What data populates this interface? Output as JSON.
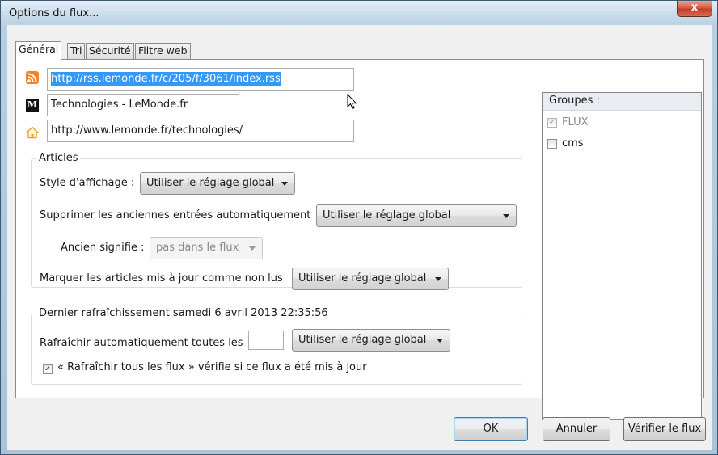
{
  "window": {
    "title": "Options du flux...",
    "close_label": "x"
  },
  "tabs": [
    {
      "label": "Général",
      "active": true
    },
    {
      "label": "Tri",
      "active": false
    },
    {
      "label": "Sécurité",
      "active": false
    },
    {
      "label": "Filtre web",
      "active": false
    }
  ],
  "feed": {
    "url": "http://rss.lemonde.fr/c/205/f/3061/index.rss",
    "name": "Technologies - LeMonde.fr",
    "homepage": "http://www.lemonde.fr/technologies/",
    "site_icon_text": "M"
  },
  "articles": {
    "legend": "Articles",
    "display_style_label": "Style d'affichage :",
    "display_style_value": "Utiliser le réglage global",
    "delete_old_label": "Supprimer les anciennes entrées automatiquement",
    "delete_old_value": "Utiliser le réglage global",
    "old_means_label": "Ancien signifie :",
    "old_means_value": "pas dans le flux",
    "mark_updated_label": "Marquer les articles mis à jour comme non lus",
    "mark_updated_value": "Utiliser le réglage global"
  },
  "refresh": {
    "legend": "Dernier rafraîchissement samedi 6 avril 2013 22:35:56",
    "auto_label": "Rafraîchir automatiquement toutes les",
    "interval_value": "",
    "auto_value": "Utiliser le réglage global",
    "refresh_all_label": "« Rafraîchir tous les flux » vérifie si ce flux a été mis à jour",
    "refresh_all_checked": true
  },
  "groups": {
    "header": "Groupes :",
    "items": [
      {
        "label": "FLUX",
        "checked": true,
        "disabled": true
      },
      {
        "label": "cms",
        "checked": false,
        "disabled": false
      }
    ]
  },
  "buttons": {
    "ok": "OK",
    "cancel": "Annuler",
    "verify": "Vérifier le flux"
  },
  "colors": {
    "rss_orange": "#f78422",
    "home_orange": "#f0a020",
    "selection": "#3399ff"
  }
}
